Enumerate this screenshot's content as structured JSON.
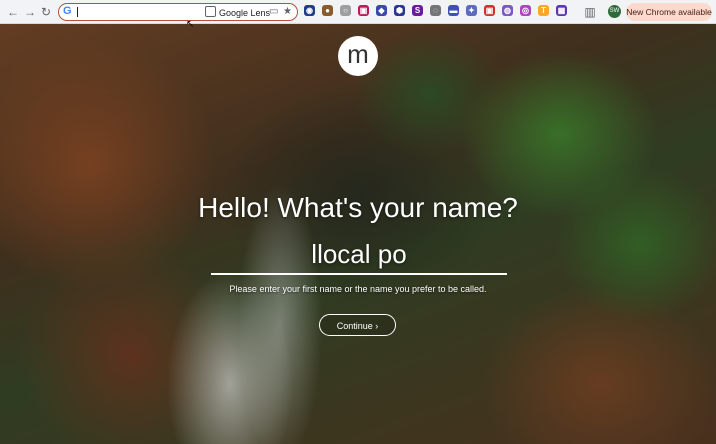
{
  "browser": {
    "omnibox_value": "",
    "google_lens_label": "Google Lens",
    "update_label": "New Chrome available",
    "profile_initials": "SW",
    "extensions": [
      {
        "icon": "extension-1-icon",
        "glyph": "◉",
        "color": "#1f3b8c"
      },
      {
        "icon": "extension-2-icon",
        "glyph": "●",
        "color": "#8a5a2b"
      },
      {
        "icon": "extension-3-icon",
        "glyph": "○",
        "color": "#9e9e9e"
      },
      {
        "icon": "extension-4-icon",
        "glyph": "▣",
        "color": "#c2185b"
      },
      {
        "icon": "extension-5-icon",
        "glyph": "◆",
        "color": "#3949ab"
      },
      {
        "icon": "extension-6-icon",
        "glyph": "⬢",
        "color": "#283593"
      },
      {
        "icon": "extension-7-icon",
        "glyph": "S",
        "color": "#6a1b9a"
      },
      {
        "icon": "extension-8-icon",
        "glyph": "◌",
        "color": "#757575"
      },
      {
        "icon": "extension-9-icon",
        "glyph": "▬",
        "color": "#3f51b5"
      },
      {
        "icon": "extension-10-icon",
        "glyph": "✦",
        "color": "#5c6bc0"
      },
      {
        "icon": "extension-11-icon",
        "glyph": "▣",
        "color": "#d32f2f"
      },
      {
        "icon": "extension-12-icon",
        "glyph": "◍",
        "color": "#7e57c2"
      },
      {
        "icon": "extension-13-icon",
        "glyph": "◎",
        "color": "#ab47bc"
      },
      {
        "icon": "extension-14-icon",
        "glyph": "T",
        "color": "#f9a825"
      },
      {
        "icon": "extension-15-icon",
        "glyph": "▦",
        "color": "#5e35b1"
      }
    ]
  },
  "page": {
    "logo_letter": "m",
    "heading": "Hello! What's your name?",
    "name_value": "llocal po",
    "hint": "Please enter your first name or the name you prefer to be called.",
    "continue_label": "Continue ›"
  }
}
